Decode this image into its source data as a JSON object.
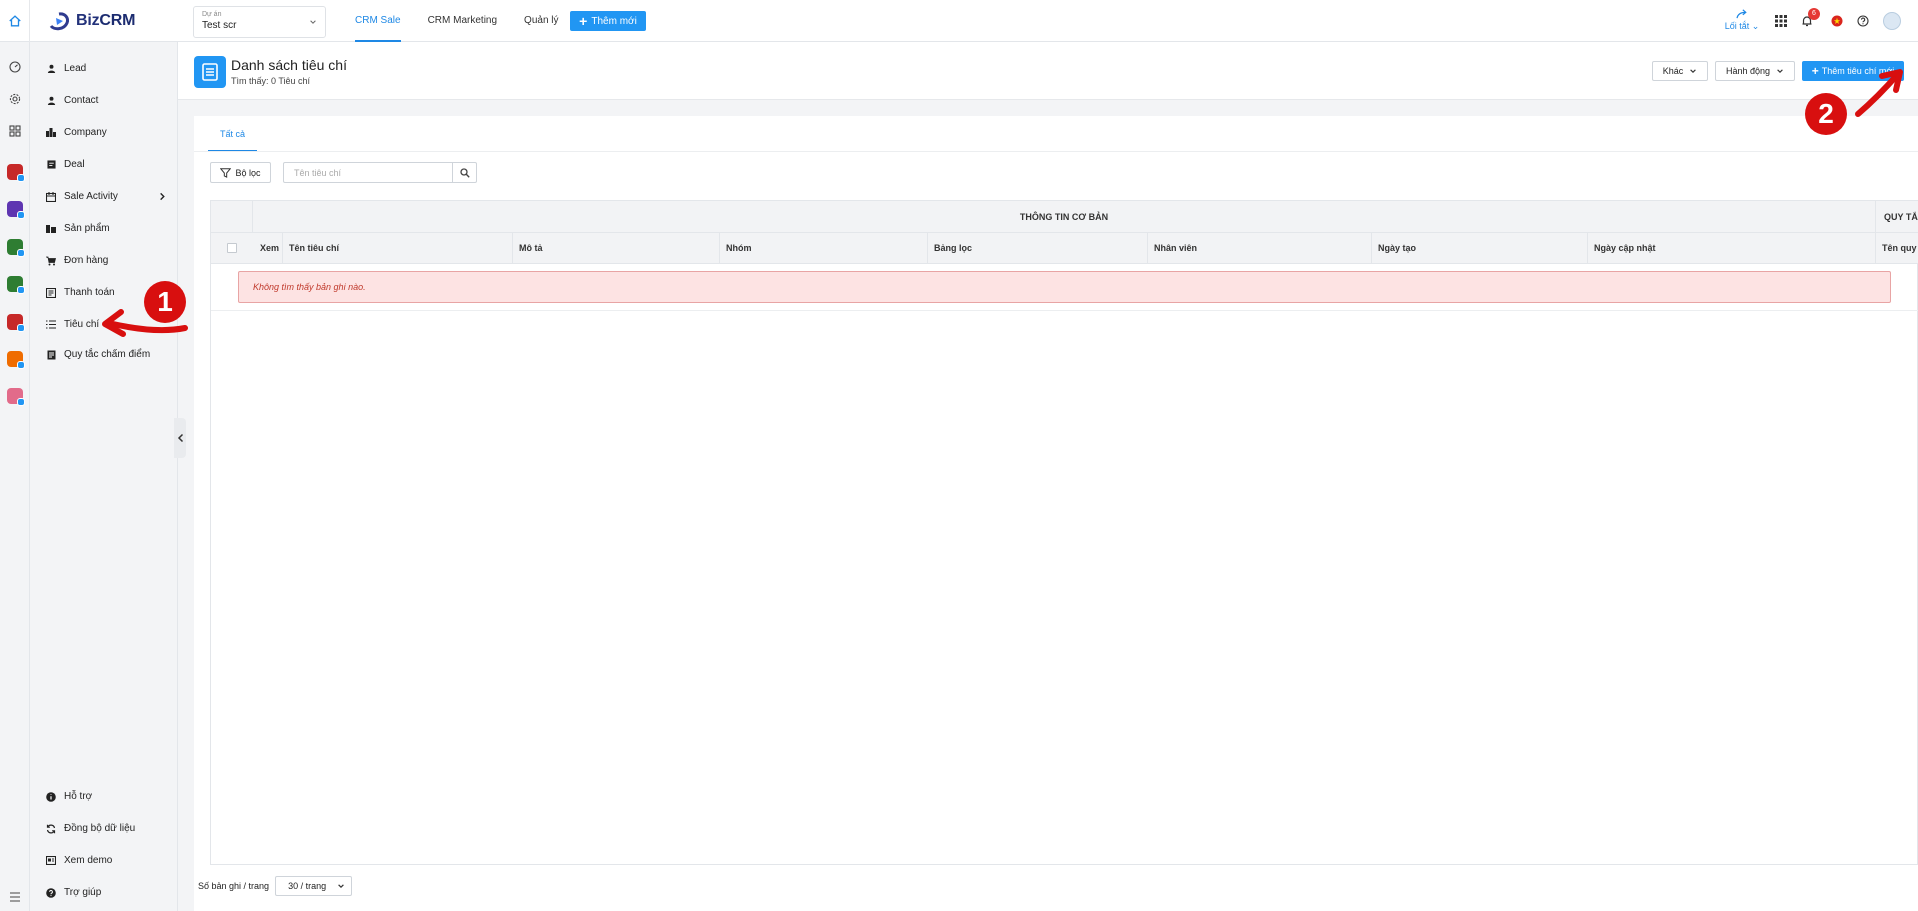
{
  "topbar": {
    "logo_text": "Biz",
    "logo_text_bold": "CRM",
    "project_label": "Dự án",
    "project_value": "Test scr",
    "tabs": [
      {
        "label": "CRM Sale"
      },
      {
        "label": "CRM Marketing"
      },
      {
        "label": "Quản lý"
      }
    ],
    "add_new_label": "Thêm mới",
    "shortcut_label": "Lối tắt",
    "notification_count": "6"
  },
  "sidebar": {
    "items": [
      {
        "label": "Lead",
        "icon": "person-icon"
      },
      {
        "label": "Contact",
        "icon": "person-icon"
      },
      {
        "label": "Company",
        "icon": "building-icon"
      },
      {
        "label": "Deal",
        "icon": "deal-icon"
      },
      {
        "label": "Sale Activity",
        "icon": "calendar-icon"
      },
      {
        "label": "Sản phẩm",
        "icon": "product-icon"
      },
      {
        "label": "Đơn hàng",
        "icon": "cart-icon"
      },
      {
        "label": "Thanh toán",
        "icon": "payment-icon"
      },
      {
        "label": "Tiêu chí",
        "icon": "list-icon"
      },
      {
        "label": "Quy tắc chấm điểm",
        "icon": "score-icon"
      }
    ],
    "bottom_items": [
      {
        "label": "Hỗ trợ",
        "icon": "info-icon"
      },
      {
        "label": "Đồng bộ dữ liệu",
        "icon": "sync-icon"
      },
      {
        "label": "Xem demo",
        "icon": "demo-icon"
      },
      {
        "label": "Trợ giúp",
        "icon": "help-icon"
      }
    ]
  },
  "header": {
    "title": "Danh sách tiêu chí",
    "subtitle": "Tìm thấy: 0 Tiêu chí",
    "other_label": "Khác",
    "action_label": "Hành động",
    "add_label": "Thêm tiêu chí mới"
  },
  "content": {
    "tab_all": "Tất cả",
    "filter_label": "Bộ lọc",
    "search_placeholder": "Tên tiêu chí",
    "group_basic": "THÔNG TIN CƠ BẢN",
    "group_rules": "QUY TẮC CHẤM",
    "columns": [
      "Xem",
      "Tên tiêu chí",
      "Mô tả",
      "Nhóm",
      "Bảng lọc",
      "Nhân viên",
      "Ngày tạo",
      "Ngày cập nhật",
      "Tên quy tắc"
    ],
    "empty_message": "Không tìm thấy bản ghi nào.",
    "pager_label": "Số bản ghi / trang",
    "pager_value": "30 / trang"
  },
  "annotations": {
    "step1": "1",
    "step2": "2",
    "color": "#d80f0f"
  },
  "colors": {
    "primary": "#2196f3",
    "brand": "#23327a",
    "error_bg": "#fde3e3",
    "error_text": "#c0392b"
  }
}
